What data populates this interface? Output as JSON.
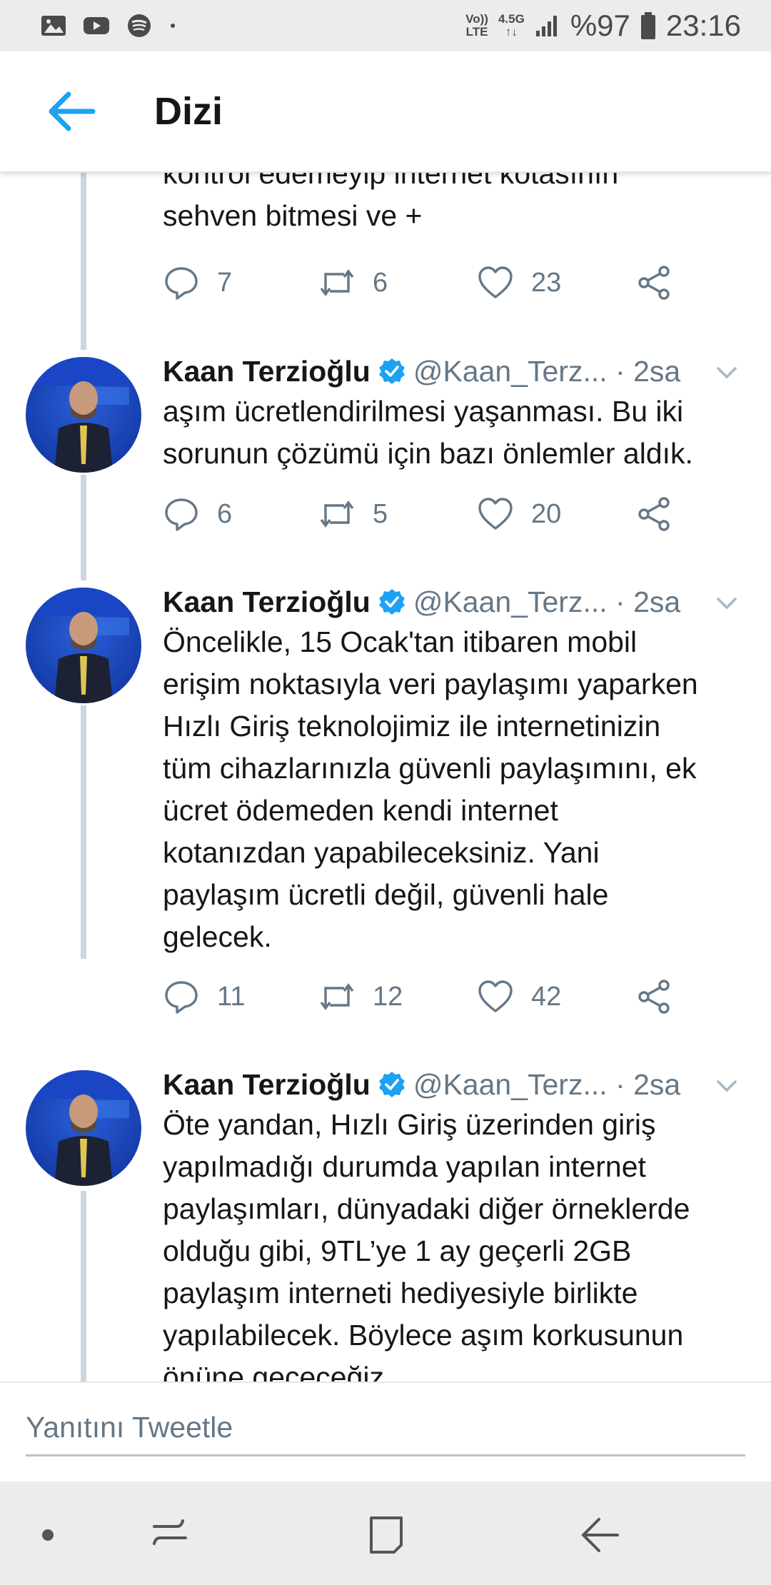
{
  "status_bar": {
    "volte_top": "Vo))",
    "volte_bottom": "LTE",
    "network_top": "4.5G",
    "network_bottom": "↑↓",
    "battery_percent": "%97",
    "time": "23:16"
  },
  "app_bar": {
    "title": "Dizi"
  },
  "first_tweet_tail": {
    "text_lines": [
      "kontrol edemeyip internet kotasının",
      "sehven bitmesi ve +"
    ],
    "reply_count": "7",
    "retweet_count": "6",
    "like_count": "23"
  },
  "tweets": [
    {
      "author": "Kaan Terzioğlu",
      "handle_time": "@Kaan_Terz... · 2sa",
      "text_lines": [
        "aşım ücretlendirilmesi yaşanması. Bu iki",
        "sorunun çözümü için bazı önlemler aldık."
      ],
      "reply_count": "6",
      "retweet_count": "5",
      "like_count": "20"
    },
    {
      "author": "Kaan Terzioğlu",
      "handle_time": "@Kaan_Terz... · 2sa",
      "text_lines": [
        "Öncelikle, 15 Ocak'tan itibaren mobil",
        "erişim noktasıyla veri paylaşımı yaparken",
        "Hızlı Giriş teknolojimiz ile internetinizin",
        "tüm cihazlarınızla güvenli paylaşımını, ek",
        "ücret ödemeden kendi internet",
        "kotanızdan yapabileceksiniz. Yani",
        "paylaşım ücretli değil, güvenli hale",
        "gelecek."
      ],
      "reply_count": "11",
      "retweet_count": "12",
      "like_count": "42"
    },
    {
      "author": "Kaan Terzioğlu",
      "handle_time": "@Kaan_Terz... · 2sa",
      "text_lines": [
        "Öte yandan, Hızlı Giriş üzerinden giriş",
        "yapılmadığı durumda yapılan internet",
        "paylaşımları, dünyadaki diğer örneklerde",
        "olduğu gibi, 9TL’ye 1 ay geçerli 2GB",
        "paylaşım interneti hediyesiyle birlikte",
        "yapılabilecek. Böylece aşım korkusunun",
        "önüne geçeceğiz."
      ]
    }
  ],
  "composer": {
    "placeholder": "Yanıtını Tweetle"
  },
  "colors": {
    "accent": "#1da1f2",
    "muted": "#657786",
    "thread_line": "#ccd6dd"
  }
}
